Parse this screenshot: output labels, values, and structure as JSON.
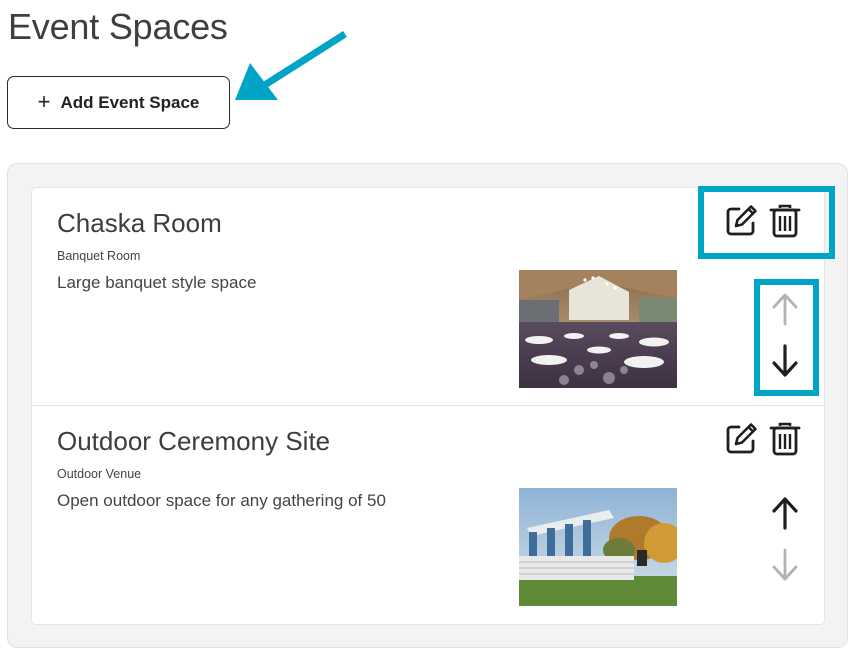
{
  "page": {
    "title": "Event Spaces"
  },
  "toolbar": {
    "add_label": "Add Event Space",
    "add_icon": "plus-icon"
  },
  "colors": {
    "highlight": "#00a4c7",
    "icon_active": "#1f1f1f",
    "icon_disabled": "#b3b3b3"
  },
  "event_spaces": [
    {
      "name": "Chaska Room",
      "type": "Banquet Room",
      "description": "Large banquet style space",
      "image": "banquet-room-photo",
      "move_up_enabled": false,
      "move_down_enabled": true
    },
    {
      "name": "Outdoor Ceremony Site",
      "type": "Outdoor Venue",
      "description": "Open outdoor space for any gathering of 50",
      "image": "outdoor-ceremony-photo",
      "move_up_enabled": true,
      "move_down_enabled": false
    }
  ],
  "icons": {
    "edit": "edit-icon",
    "delete": "trash-icon",
    "up": "arrow-up-icon",
    "down": "arrow-down-icon"
  }
}
